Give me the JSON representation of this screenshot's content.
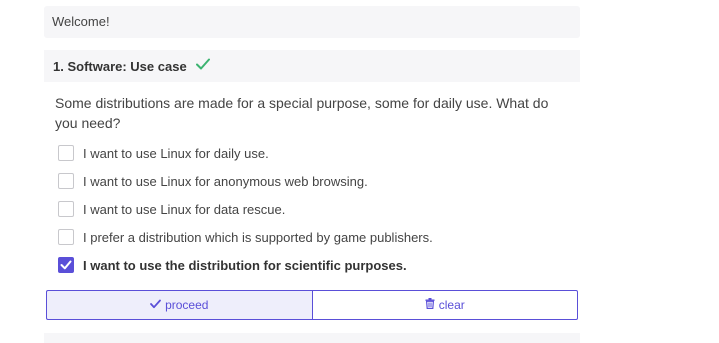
{
  "welcome": {
    "text": "Welcome!"
  },
  "question": {
    "title": "1. Software: Use case",
    "answered_icon": "checkmark-icon",
    "answered_color": "#3cb371",
    "text": "Some distributions are made for a special purpose, some for daily use. What do you need?",
    "options": [
      {
        "label": "I want to use Linux for daily use.",
        "checked": false
      },
      {
        "label": "I want to use Linux for anonymous web browsing.",
        "checked": false
      },
      {
        "label": "I want to use Linux for data rescue.",
        "checked": false
      },
      {
        "label": "I prefer a distribution which is supported by game publishers.",
        "checked": false
      },
      {
        "label": "I want to use the distribution for scientific purposes.",
        "checked": true
      }
    ]
  },
  "buttons": {
    "proceed_label": "proceed",
    "proceed_icon": "checkmark-icon",
    "clear_label": "clear",
    "clear_icon": "trash-icon"
  },
  "colors": {
    "accent": "#5a4fd8",
    "panel_bg": "#f6f6f8",
    "success": "#3cb371"
  }
}
